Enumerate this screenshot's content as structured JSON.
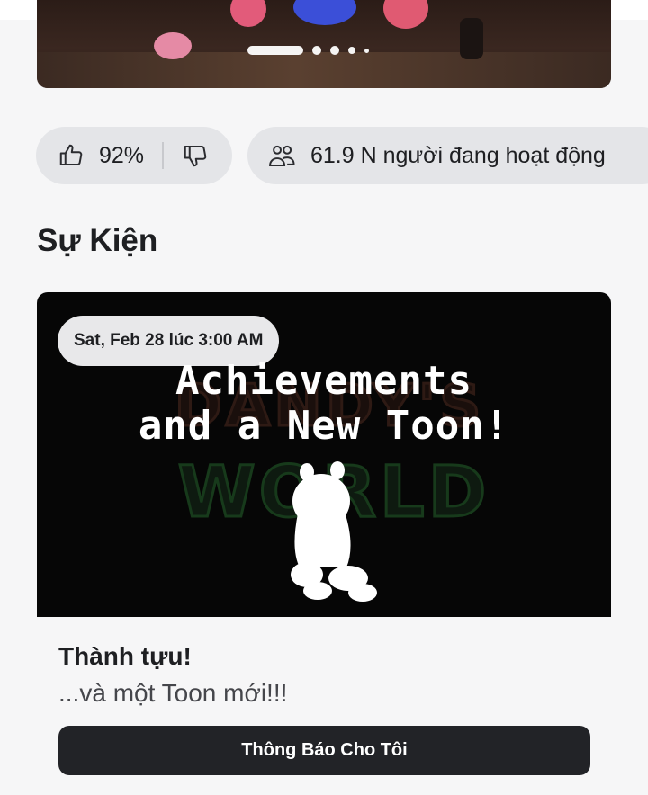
{
  "carousel": {
    "slide_count": 5,
    "active_index": 0
  },
  "stats": {
    "like_percent": "92%",
    "thumbs_up_icon": "thumbs-up-icon",
    "thumbs_down_icon": "thumbs-down-icon",
    "active_users": "61.9 N người đang hoạt động",
    "people_icon": "people-icon"
  },
  "events_section": {
    "title": "Sự Kiện"
  },
  "event": {
    "date_badge": "Sat, Feb 28 lúc 3:00 AM",
    "headline_line1": "Achievements",
    "headline_line2": "and a New Toon!",
    "title": "Thành tựu!",
    "description": "...và một Toon mới!!!",
    "notify_button": "Thông Báo Cho Tôi"
  }
}
